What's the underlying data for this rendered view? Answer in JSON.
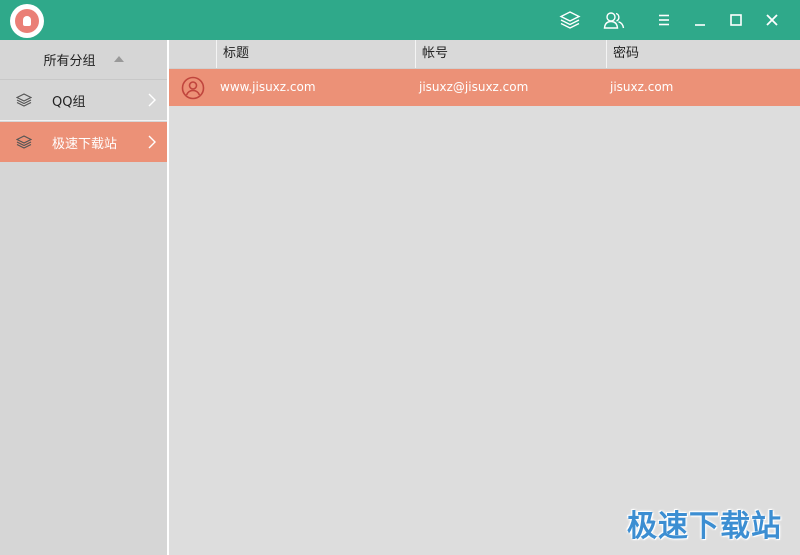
{
  "sidebar": {
    "header": "所有分组",
    "items": [
      {
        "label": "QQ组",
        "icon": "layers-icon"
      },
      {
        "label": "极速下载站",
        "icon": "layers-icon"
      }
    ]
  },
  "table": {
    "columns": [
      "",
      "标题",
      "帐号",
      "密码"
    ],
    "rows": [
      {
        "title": "www.jisuxz.com",
        "account": "jisuxz@jisuxz.com",
        "password": "jisuxz.com"
      }
    ]
  },
  "watermark": "极速下载站",
  "colors": {
    "titlebar": "#2fa98a",
    "accent": "#ec9177",
    "logo": "#ea7f76"
  }
}
